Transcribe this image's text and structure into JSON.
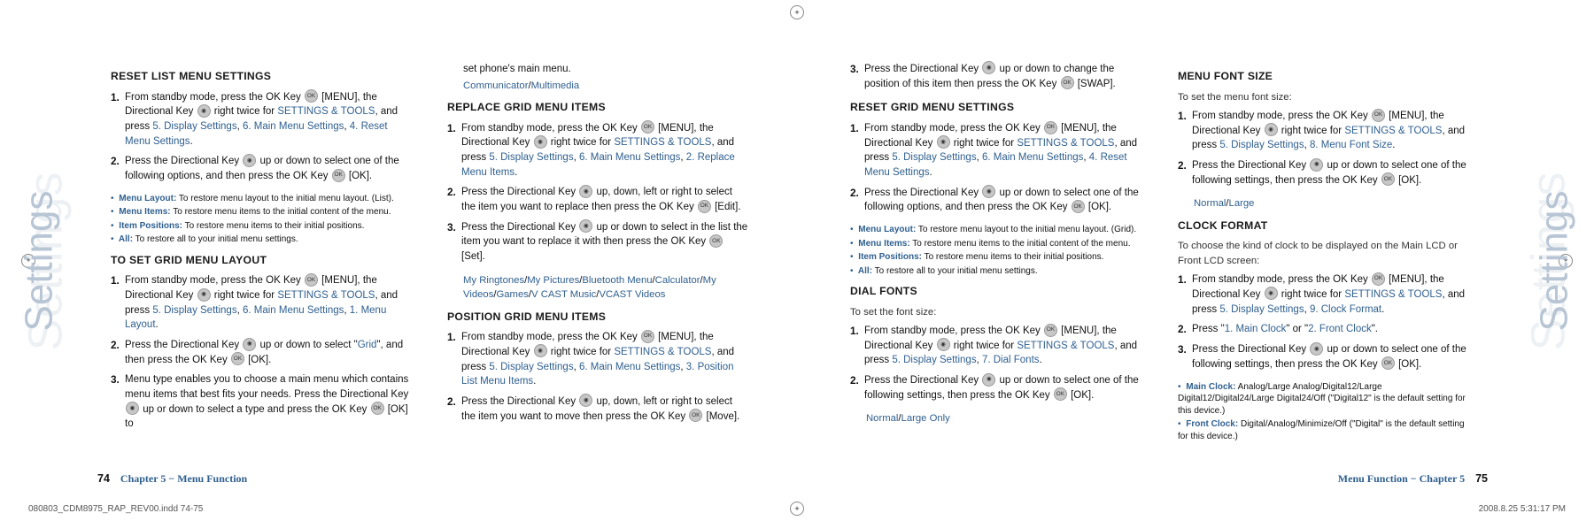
{
  "sideLabel": "Settings",
  "leftPage": {
    "col1": {
      "h1": "RESET LIST MENU SETTINGS",
      "steps1": [
        {
          "n": "1.",
          "pre": "From standby mode, press the OK Key ",
          "icon": "OK",
          "mid": " [MENU], the Directional Key ",
          "icon2": "dir",
          "aft": " right twice for ",
          "link": "SETTINGS & TOOLS",
          "aft2": ", and press ",
          "link2": "5. Display Settings",
          "aft3": ", ",
          "link3": "6. Main Menu Settings",
          "aft4": ", ",
          "link4": "4. Reset Menu Settings",
          "aft5": "."
        },
        {
          "n": "2.",
          "pre": "Press the Directional Key ",
          "icon": "dir",
          "mid": " up or down to select one of the following options, and then press the OK Key ",
          "icon2": "OK",
          "aft": " [OK]."
        }
      ],
      "bullets1": [
        {
          "lbl": "Menu Layout:",
          "txt": "  To restore menu layout to the initial menu layout. (List)."
        },
        {
          "lbl": "Menu Items:",
          "txt": "  To restore menu items to the initial content of the menu."
        },
        {
          "lbl": "Item Positions:",
          "txt": "  To restore menu items to their initial positions."
        },
        {
          "lbl": "All:",
          "txt": "  To restore all to your initial menu settings."
        }
      ],
      "h2": "TO SET GRID MENU LAYOUT",
      "steps2": [
        {
          "n": "1.",
          "pre": "From standby mode, press the OK Key ",
          "icon": "OK",
          "mid": " [MENU], the Directional Key ",
          "icon2": "dir",
          "aft": " right twice for ",
          "link": "SETTINGS & TOOLS",
          "aft2": ", and press ",
          "link2": "5. Display Settings",
          "aft3": ", ",
          "link3": "6. Main Menu Settings",
          "aft4": ", ",
          "link4": "1. Menu Layout",
          "aft5": "."
        },
        {
          "n": "2.",
          "pre": "Press the Directional Key ",
          "icon": "dir",
          "mid": " up or down to select \"",
          "link": "Grid",
          "aft": "\", and then press the OK Key ",
          "icon2": "OK",
          "aft2": " [OK]."
        },
        {
          "n": "3.",
          "pre": "Menu type enables you to choose a main menu which contains menu items that best fits your needs. Press the Directional Key ",
          "icon": "dir",
          "mid": " up or down to select a type and press the OK Key ",
          "icon2": "OK",
          "aft": " [OK] to"
        }
      ]
    },
    "col2": {
      "cont": "set phone's main menu.",
      "contLink": "Communicator/Multimedia",
      "h1": "REPLACE GRID MENU ITEMS",
      "steps1": [
        {
          "n": "1.",
          "pre": "From standby mode, press the OK Key ",
          "icon": "OK",
          "mid": " [MENU], the Directional Key ",
          "icon2": "dir",
          "aft": " right twice for ",
          "link": "SETTINGS & TOOLS",
          "aft2": ", and press ",
          "link2": "5. Display Settings",
          "aft3": ", ",
          "link3": "6. Main Menu Settings",
          "aft4": ", ",
          "link4": "2. Replace Menu Items",
          "aft5": "."
        },
        {
          "n": "2.",
          "pre": "Press the Directional Key ",
          "icon": "dir",
          "mid": " up, down, left or right to select the item you want to replace then press the OK Key ",
          "icon2": "OK",
          "aft": " [Edit]."
        },
        {
          "n": "3.",
          "pre": "Press the Directional Key ",
          "icon": "dir",
          "mid": " up or down to select in the list the item you want to replace it with then press the OK Key ",
          "icon2": "OK",
          "aft": " [Set]."
        }
      ],
      "links1": "My Ringtones/My Pictures/Bluetooth Menu/Calculator/My Videos/Games/V CAST Music/VCAST Videos",
      "h2": "POSITION GRID MENU ITEMS",
      "steps2": [
        {
          "n": "1.",
          "pre": "From standby mode, press the OK Key ",
          "icon": "OK",
          "mid": " [MENU], the Directional Key ",
          "icon2": "dir",
          "aft": " right twice for ",
          "link": "SETTINGS & TOOLS",
          "aft2": ", and press ",
          "link2": "5. Display Settings",
          "aft3": ", ",
          "link3": "6. Main Menu Settings",
          "aft4": ", ",
          "link4": "3. Position List Menu Items",
          "aft5": "."
        },
        {
          "n": "2.",
          "pre": "Press the Directional Key ",
          "icon": "dir",
          "mid": " up, down, left or right to select the item you want to move then press the OK Key ",
          "icon2": "OK",
          "aft": " [Move]."
        }
      ]
    },
    "footerNum": "74",
    "footerText": "Chapter 5 − Menu Function"
  },
  "rightPage": {
    "col1": {
      "steps0": [
        {
          "n": "3.",
          "pre": "Press the Directional Key ",
          "icon": "dir",
          "mid": " up or down to change the position of this item then press the OK Key ",
          "icon2": "OK",
          "aft": " [SWAP]."
        }
      ],
      "h1": "RESET GRID MENU SETTINGS",
      "steps1": [
        {
          "n": "1.",
          "pre": "From standby mode, press the OK Key ",
          "icon": "OK",
          "mid": " [MENU], the Directional Key ",
          "icon2": "dir",
          "aft": " right twice for ",
          "link": "SETTINGS & TOOLS",
          "aft2": ", and press ",
          "link2": "5. Display Settings",
          "aft3": ", ",
          "link3": "6. Main Menu Settings",
          "aft4": ", ",
          "link4": "4. Reset Menu Settings",
          "aft5": "."
        },
        {
          "n": "2.",
          "pre": "Press the Directional Key ",
          "icon": "dir",
          "mid": " up or down to select one of the following options, and then press the OK Key ",
          "icon2": "OK",
          "aft": " [OK]."
        }
      ],
      "bullets1": [
        {
          "lbl": "Menu Layout:",
          "txt": "  To restore menu layout to the initial menu layout. (Grid)."
        },
        {
          "lbl": "Menu Items:",
          "txt": "  To restore menu items to the initial content of the menu."
        },
        {
          "lbl": "Item Positions:",
          "txt": "  To restore menu items to their initial positions."
        },
        {
          "lbl": "All:",
          "txt": "  To restore all to your initial menu settings."
        }
      ],
      "h2": "DIAL FONTS",
      "sub2": "To set the font size:",
      "steps2": [
        {
          "n": "1.",
          "pre": "From standby mode, press the OK Key ",
          "icon": "OK",
          "mid": " [MENU], the Directional Key ",
          "icon2": "dir",
          "aft": " right twice for ",
          "link": "SETTINGS & TOOLS",
          "aft2": ", and press ",
          "link2": "5. Display Settings",
          "aft3": ", ",
          "link3": "7. Dial Fonts",
          "aft4": "."
        },
        {
          "n": "2.",
          "pre": "Press the Directional Key ",
          "icon": "dir",
          "mid": " up or down to select one of the following settings, then press the OK Key ",
          "icon2": "OK",
          "aft": " [OK]."
        }
      ],
      "links2": "Normal/Large Only"
    },
    "col2": {
      "h1": "MENU FONT SIZE",
      "sub1": "To set the menu font size:",
      "steps1": [
        {
          "n": "1.",
          "pre": "From standby mode, press the OK Key ",
          "icon": "OK",
          "mid": " [MENU], the Directional Key ",
          "icon2": "dir",
          "aft": " right twice for ",
          "link": "SETTINGS & TOOLS",
          "aft2": ", and press ",
          "link2": "5. Display Settings",
          "aft3": ", ",
          "link3": "8. Menu Font Size",
          "aft4": "."
        },
        {
          "n": "2.",
          "pre": "Press the Directional Key ",
          "icon": "dir",
          "mid": " up or down to select one of the following settings, then press the OK Key ",
          "icon2": "OK",
          "aft": " [OK]."
        }
      ],
      "links1": "Normal/Large",
      "h2": "CLOCK FORMAT",
      "sub2": "To choose the kind of clock to be displayed on the Main LCD or Front LCD screen:",
      "steps2": [
        {
          "n": "1.",
          "pre": "From standby mode, press the OK Key ",
          "icon": "OK",
          "mid": " [MENU], the Directional Key ",
          "icon2": "dir",
          "aft": " right twice for ",
          "link": "SETTINGS & TOOLS",
          "aft2": ", and press ",
          "link2": "5. Display Settings",
          "aft3": ", ",
          "link3": "9. Clock Format",
          "aft4": "."
        },
        {
          "n": "2.",
          "pre": "Press \"",
          "link": "1. Main Clock",
          "mid": "\" or \"",
          "link2": "2. Front Clock",
          "aft": "\"."
        },
        {
          "n": "3.",
          "pre": "Press the Directional Key ",
          "icon": "dir",
          "mid": " up or down to select one of the following settings, then press the OK Key ",
          "icon2": "OK",
          "aft": " [OK]."
        }
      ],
      "bullets2": [
        {
          "lbl": "Main Clock:",
          "txt": "  Analog/Large Analog/Digital12/Large Digital12/Digital24/Large Digital24/Off (\"Digital12\" is the default setting for this device.)"
        },
        {
          "lbl": "Front Clock:",
          "txt": "  Digital/Analog/Minimize/Off (\"Digital\" is the default setting for this device.)"
        }
      ]
    },
    "footerText": "Menu Function − Chapter 5",
    "footerNum": "75"
  },
  "printFile": "080803_CDM8975_RAP_REV00.indd   74-75",
  "printTime": "2008.8.25   5:31:17 PM"
}
